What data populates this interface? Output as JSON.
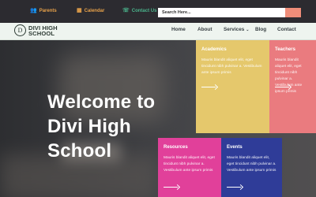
{
  "topbar": {
    "parents": {
      "label": "Parents",
      "icon": "people-icon"
    },
    "calendar": {
      "label": "Calendar",
      "icon": "calendar-icon"
    },
    "contact": {
      "label": "Contact Us",
      "icon": "phone-icon"
    },
    "search": {
      "placeholder": "Search Here...",
      "button_label": "Search"
    }
  },
  "logo": {
    "mark": "D",
    "line1": "DIVI HIGH",
    "line2": "SCHOOL"
  },
  "nav": {
    "home": "Home",
    "about": "About",
    "services": "Services",
    "blog": "Blog",
    "contact": "Contact"
  },
  "hero": {
    "title_line1": "Welcome to",
    "title_line2": "Divi High",
    "title_line3": "School"
  },
  "cards": {
    "academics": {
      "title": "Academics",
      "text": "Mauris blandit aliquet elit, eget tincidunt nibh pulvinar a. Vestibulum ante ipsum primis",
      "color": "#e5c86c"
    },
    "teachers": {
      "title": "Teachers",
      "text": "Mauris blandit aliquet elit, eget tincidunt nibh pulvinar a. Vestibulum ante ipsum primis",
      "color": "#ea7b7f"
    },
    "resources": {
      "title": "Resources",
      "text": "Mauris blandit aliquet elit, eget tincidunt nibh pulvinar a. Vestibulum ante ipsum primis",
      "color": "#e1409a"
    },
    "events": {
      "title": "Events",
      "text": "Mauris blandit aliquet elit, eget tincidunt nibh pulvinar a. Vestibulum ante ipsum primis",
      "color": "#2f3c98"
    }
  },
  "colors": {
    "topbar_accent": "#e8a24a",
    "search_button": "#ef8d79",
    "contact_green": "#4bb48c"
  }
}
